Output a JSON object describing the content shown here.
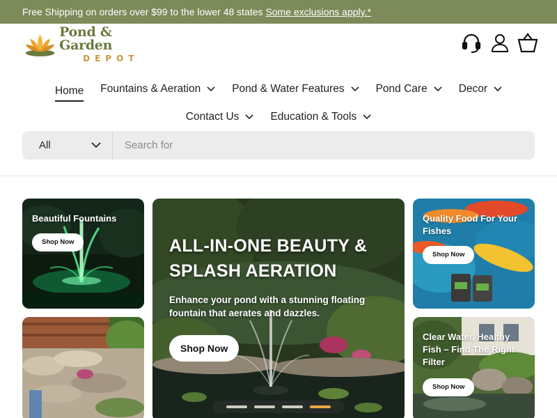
{
  "announcement": {
    "text": "Free Shipping on orders over $99 to the lower 48 states ",
    "link": "Some exclusions apply.*"
  },
  "logo": {
    "line1": "Pond & Garden",
    "line2": "DEPOT"
  },
  "header_icons": [
    "headset-icon",
    "account-icon",
    "cart-icon"
  ],
  "nav": {
    "row1": [
      {
        "label": "Home",
        "dropdown": false,
        "active": true
      },
      {
        "label": "Fountains & Aeration",
        "dropdown": true
      },
      {
        "label": "Pond & Water Features",
        "dropdown": true
      },
      {
        "label": "Pond Care",
        "dropdown": true
      },
      {
        "label": "Decor",
        "dropdown": true
      }
    ],
    "row2": [
      {
        "label": "Contact Us",
        "dropdown": true
      },
      {
        "label": "Education & Tools",
        "dropdown": true
      }
    ]
  },
  "search": {
    "category": "All",
    "placeholder": "Search for"
  },
  "tiles": {
    "fountains": {
      "title": "Beautiful Fountains",
      "cta": "Shop Now"
    },
    "food": {
      "title": "Quality Food For Your Fishes",
      "cta": "Shop Now"
    },
    "filter": {
      "title": "Clear Water, Healthy Fish – Find The Right Filter",
      "cta": "Shop Now"
    }
  },
  "hero": {
    "heading": "ALL-IN-ONE BEAUTY & SPLASH AERATION",
    "body": "Enhance your pond with a stunning floating fountain that aerates and dazzles.",
    "cta": "Shop Now",
    "slides": 4,
    "active_slide": 4
  },
  "colors": {
    "announce_bg": "#7d8b5a",
    "brand_green": "#6b7a3f",
    "brand_gold": "#c89a3a",
    "active_dot": "#e8a94a"
  }
}
